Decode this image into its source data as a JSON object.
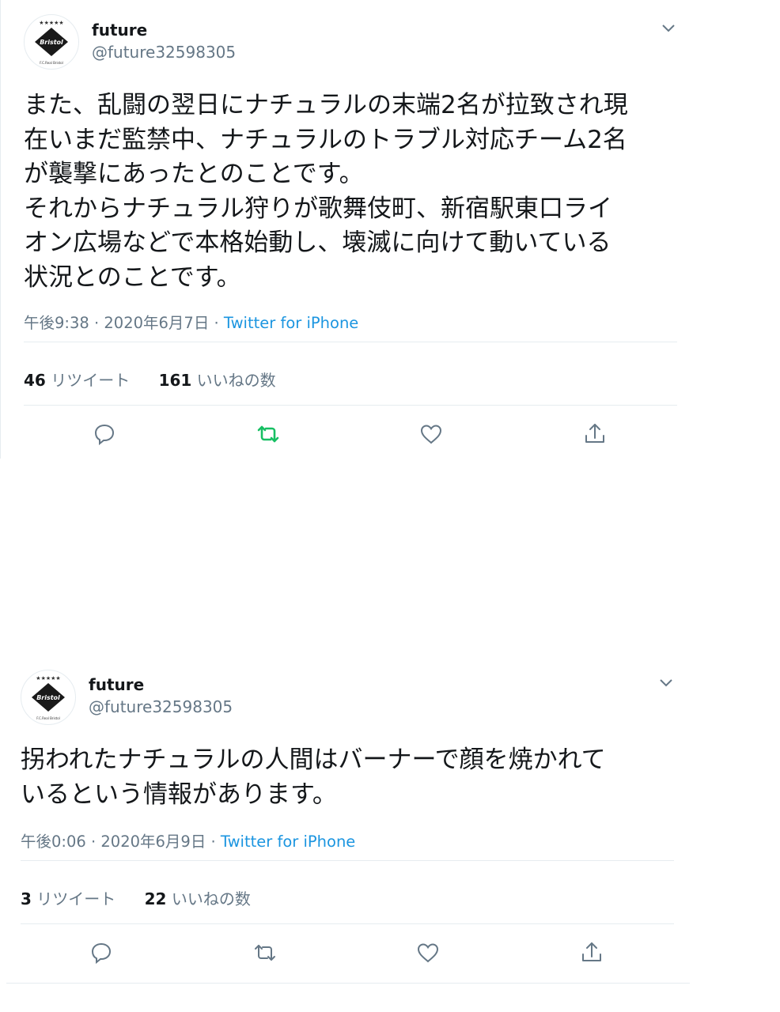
{
  "colors": {
    "link": "#1b95e0",
    "muted": "#657786",
    "retweet_active": "#17bf63",
    "text": "#14171a"
  },
  "tweets": [
    {
      "avatar_icon": "bristol-logo-avatar",
      "name": "future",
      "handle": "@future32598305",
      "text": "また、乱闘の翌日にナチュラルの末端2名が拉致され現\n在いまだ監禁中、ナチュラルのトラブル対応チーム2名\nが襲撃にあったとのことです。\nそれからナチュラル狩りが歌舞伎町、新宿駅東口ライ\nオン広場などで本格始動し、壊滅に向けて動いている\n状況とのことです。",
      "time": "午後9:38 · 2020年6月7日 · ",
      "source": "Twitter for iPhone",
      "retweets": "46",
      "retweets_label": "リツイート",
      "likes": "161",
      "likes_label": "いいねの数",
      "retweet_state": "active"
    },
    {
      "avatar_icon": "bristol-logo-avatar",
      "name": "future",
      "handle": "@future32598305",
      "text": "拐われたナチュラルの人間はバーナーで顔を焼かれて\nいるという情報があります。",
      "time": "午後0:06 · 2020年6月9日 · ",
      "source": "Twitter for iPhone",
      "retweets": "3",
      "retweets_label": "リツイート",
      "likes": "22",
      "likes_label": "いいねの数",
      "retweet_state": "inactive"
    }
  ]
}
